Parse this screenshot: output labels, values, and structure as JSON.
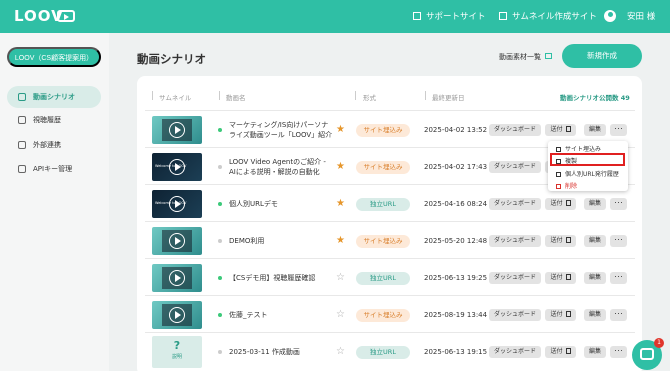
{
  "header": {
    "logo": "LOOV",
    "support_label": "サポートサイト",
    "thumb_site_label": "サムネイル作成サイト",
    "user_name": "安田 様"
  },
  "sidebar": {
    "org_label": "LOOV（CS顧客提案用）",
    "items": [
      {
        "label": "動画シナリオ"
      },
      {
        "label": "視聴履歴"
      },
      {
        "label": "外部連携"
      },
      {
        "label": "APIキー管理"
      }
    ]
  },
  "main": {
    "title": "動画シナリオ",
    "material_link": "動画素材一覧",
    "new_button": "新規作成",
    "columns": {
      "thumbnail": "サムネイル",
      "name": "動画名",
      "format": "形式",
      "updated": "最終更新日"
    },
    "public_count": "動画シナリオ公開数 49"
  },
  "rows": [
    {
      "name": "マーケティング/IS向けパーソナライズ動画ツール「LOOV」紹介",
      "status_color": "#3cc97a",
      "favorite": true,
      "format": "サイト埋込み",
      "date": "2025-04-02 13:52"
    },
    {
      "name": "LOOV Video Agentのご紹介 - AIによる説明・解説の自動化",
      "status_color": "#cccccc",
      "favorite": true,
      "format": "サイト埋込み",
      "date": "2025-04-02 17:43"
    },
    {
      "name": "個人別URLデモ",
      "status_color": "#3cc97a",
      "favorite": true,
      "format": "独立URL",
      "date": "2025-04-16 08:24"
    },
    {
      "name": "DEMO利用",
      "status_color": "#cccccc",
      "favorite": true,
      "format": "サイト埋込み",
      "date": "2025-05-20 12:48"
    },
    {
      "name": "【CSデモ用】視聴履歴確認",
      "status_color": "#3cc97a",
      "favorite": false,
      "format": "独立URL",
      "date": "2025-06-13 19:25"
    },
    {
      "name": "佐藤_テスト",
      "status_color": "#3cc97a",
      "favorite": false,
      "format": "サイト埋込み",
      "date": "2025-08-19 13:44"
    },
    {
      "name": "2025-03-11 作成動画",
      "status_color": "#cccccc",
      "favorite": false,
      "format": "独立URL",
      "date": "2025-06-13 19:15"
    }
  ],
  "row_buttons": {
    "dashboard": "ダッシュボード",
    "send": "送付",
    "edit": "編集",
    "more": "･･･"
  },
  "thumb_question": {
    "mark": "?",
    "label": "説明"
  },
  "dark_thumb_text": "Welcome to LOOV",
  "context_menu": {
    "items": [
      "サイト埋込み",
      "複製",
      "個人別URL発行履歴",
      "削除"
    ]
  },
  "chat": {
    "badge_count": "1"
  },
  "colors": {
    "brand": "#2fbfa5",
    "star": "#e6962b",
    "embed_badge": "#d9802e",
    "solo_badge": "#2a9b86",
    "delete": "#d9302b"
  }
}
